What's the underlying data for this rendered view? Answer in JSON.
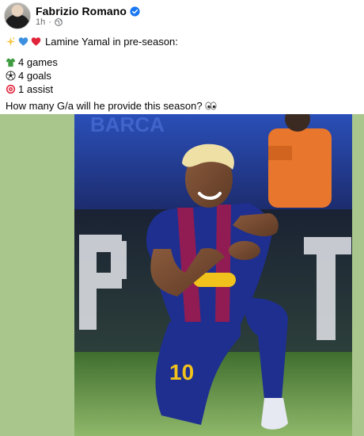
{
  "post": {
    "author": "Fabrizio Romano",
    "timestamp": "1h",
    "meta_separator": "·",
    "headline": "Lamine Yamal in pre-season:",
    "stats": [
      {
        "icon": "jersey-icon",
        "text": "4 games"
      },
      {
        "icon": "soccer-ball-icon",
        "text": "4 goals"
      },
      {
        "icon": "target-icon",
        "text": "1 assist"
      }
    ],
    "question": "How many G/a will he provide this season?"
  },
  "photo": {
    "jersey_number": "10"
  },
  "colors": {
    "verified": "#1877f2",
    "meta_text": "#65676b",
    "frame_background": "#a9c68c",
    "barca_blue": "#1e2f8f",
    "barca_red": "#a6194a"
  }
}
